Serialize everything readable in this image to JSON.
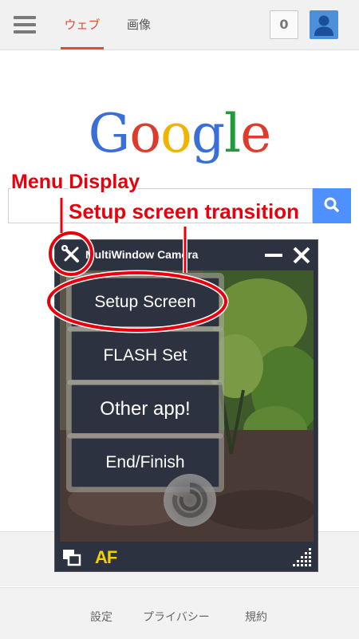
{
  "topbar": {
    "tabs": [
      {
        "label": "ウェブ",
        "active": true
      },
      {
        "label": "画像",
        "active": false
      }
    ],
    "notification_count": "0"
  },
  "logo": {
    "letters": [
      {
        "char": "G",
        "color": "#3a6fd8"
      },
      {
        "char": "o",
        "color": "#dd3b2b"
      },
      {
        "char": "o",
        "color": "#f0b400"
      },
      {
        "char": "g",
        "color": "#3a6fd8"
      },
      {
        "char": "l",
        "color": "#1e9b3c"
      },
      {
        "char": "e",
        "color": "#dd3b2b"
      }
    ]
  },
  "search": {
    "button_icon": "search-icon"
  },
  "camera_app": {
    "title": "MultiWindow Camera",
    "menu": [
      {
        "label": "Setup Screen"
      },
      {
        "label": "FLASH Set"
      },
      {
        "label": "Other app!"
      },
      {
        "label": "End/Finish"
      }
    ],
    "af_label": "AF",
    "icons": [
      "wrench-screwdriver-icon",
      "minimize-icon",
      "close-icon",
      "window-switch-icon",
      "resize-grip-icon",
      "shutter-icon"
    ]
  },
  "annotations": {
    "menu_display": "Menu Display",
    "setup_transition": "Setup screen transition",
    "color": "#e8000d"
  },
  "footer": {
    "links": [
      {
        "label": "設定"
      },
      {
        "label": "プライバシー"
      },
      {
        "label": "規約"
      }
    ]
  }
}
